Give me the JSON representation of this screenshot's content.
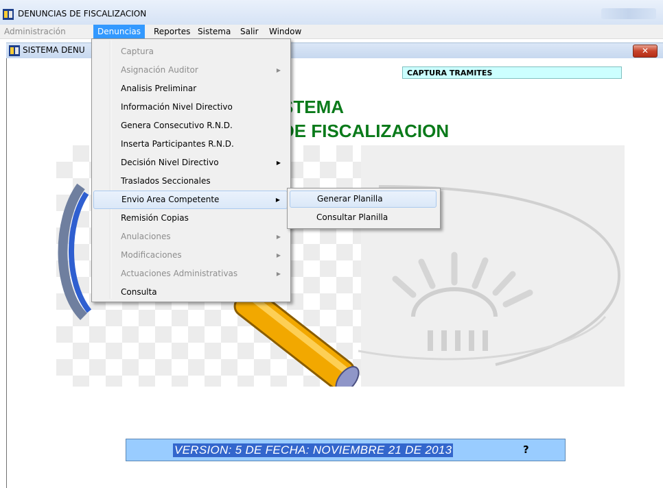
{
  "window": {
    "title": "DENUNCIAS DE FISCALIZACION"
  },
  "menubar": {
    "items": [
      {
        "label": "Administración",
        "state": "disabled"
      },
      {
        "label": "Denuncias",
        "state": "active"
      },
      {
        "label": "Reportes",
        "state": "normal"
      },
      {
        "label": "Sistema",
        "state": "normal"
      },
      {
        "label": "Salir",
        "state": "normal"
      },
      {
        "label": "Window",
        "state": "normal"
      }
    ]
  },
  "child_window": {
    "title": "SISTEMA DENU",
    "close_glyph": "✕"
  },
  "content": {
    "captura_label": "CAPTURA TRAMITES",
    "heading_line1": "STEMA",
    "heading_line2": "DE FISCALIZACION",
    "version_text": "VERSION:  5 DE FECHA:  NOVIEMBRE 21 DE 2013",
    "cursor_glyph": "?"
  },
  "denuncias_menu": {
    "items": [
      {
        "label": "Captura",
        "enabled": false,
        "submenu": false
      },
      {
        "label": "Asignación Auditor",
        "enabled": false,
        "submenu": true
      },
      {
        "label": "Analisis Preliminar",
        "enabled": true,
        "submenu": false
      },
      {
        "label": "Información Nivel Directivo",
        "enabled": true,
        "submenu": false
      },
      {
        "label": "Genera Consecutivo R.N.D.",
        "enabled": true,
        "submenu": false
      },
      {
        "label": "Inserta Participantes R.N.D.",
        "enabled": true,
        "submenu": false
      },
      {
        "label": "Decisión  Nivel Directivo",
        "enabled": true,
        "submenu": true
      },
      {
        "label": "Traslados Seccionales",
        "enabled": true,
        "submenu": false
      },
      {
        "label": "Envio Area Competente",
        "enabled": true,
        "submenu": true,
        "highlighted": true
      },
      {
        "label": "Remisión  Copias",
        "enabled": true,
        "submenu": false
      },
      {
        "label": "Anulaciones",
        "enabled": false,
        "submenu": true
      },
      {
        "label": "Modificaciones",
        "enabled": false,
        "submenu": true
      },
      {
        "label": "Actuaciones Administrativas",
        "enabled": false,
        "submenu": true
      },
      {
        "label": "Consulta",
        "enabled": true,
        "submenu": false
      }
    ],
    "submenu_arrow_glyph": "▶"
  },
  "envio_submenu": {
    "items": [
      {
        "label": "Generar Planilla",
        "highlighted": true
      },
      {
        "label": "Consultar Planilla",
        "highlighted": false
      }
    ]
  },
  "colors": {
    "menu_active": "#3399ff",
    "heading_green": "#0a7a1a",
    "captura_bg": "#ccffff",
    "version_bg": "#99ccff",
    "close_button": "#c7432a"
  }
}
